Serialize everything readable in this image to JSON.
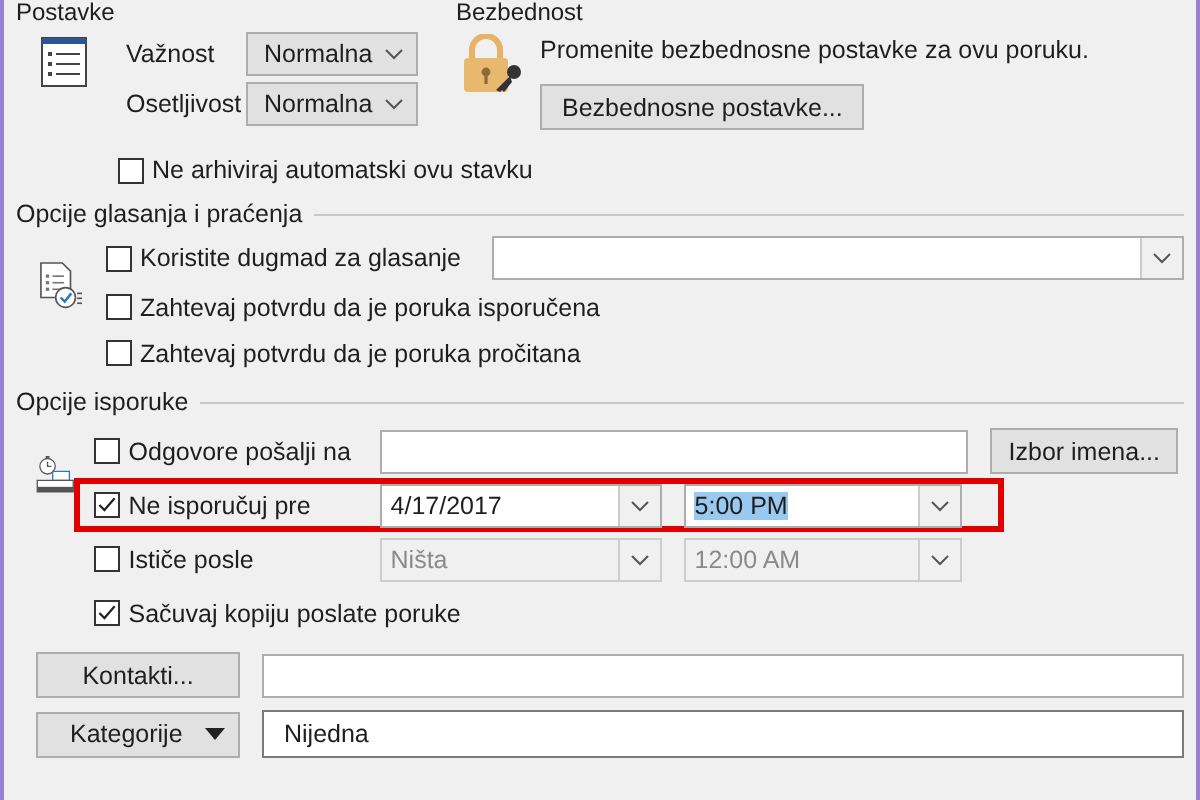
{
  "settings": {
    "title": "Postavke",
    "fields": [
      {
        "label": "Važnost",
        "value": "Normalna"
      },
      {
        "label": "Osetljivost",
        "value": "Normalna"
      }
    ],
    "archive": {
      "label": "Ne arhiviraj automatski ovu stavku",
      "checked": false
    }
  },
  "security": {
    "title": "Bezbednost",
    "text": "Promenite bezbednosne postavke za ovu poruku.",
    "button": "Bezbednosne postavke..."
  },
  "voting": {
    "title": "Opcije glasanja i praćenja",
    "items": [
      {
        "label": "Koristite dugmad za glasanje",
        "checked": false
      },
      {
        "label": "Zahtevaj potvrdu da je poruka isporučena",
        "checked": false
      },
      {
        "label": "Zahtevaj potvrdu da je poruka pročitana",
        "checked": false
      }
    ]
  },
  "delivery": {
    "title": "Opcije isporuke",
    "reply_to": {
      "label": "Odgovore pošalji na",
      "checked": false,
      "button": "Izbor imena..."
    },
    "defer": {
      "label": "Ne isporučuj pre",
      "checked": true,
      "highlighted": true,
      "date": "4/17/2017",
      "time": "5:00 PM",
      "time_selected": true,
      "disabled": false
    },
    "expires": {
      "label": "Ističe posle",
      "checked": false,
      "date": "Ništa",
      "time": "12:00 AM",
      "time_selected": false,
      "disabled": true
    },
    "save_copy": {
      "label": "Sačuvaj kopiju poslate poruke",
      "checked": true
    }
  },
  "contacts": {
    "button": "Kontakti..."
  },
  "categories": {
    "button": "Kategorije",
    "value": "Nijedna"
  }
}
